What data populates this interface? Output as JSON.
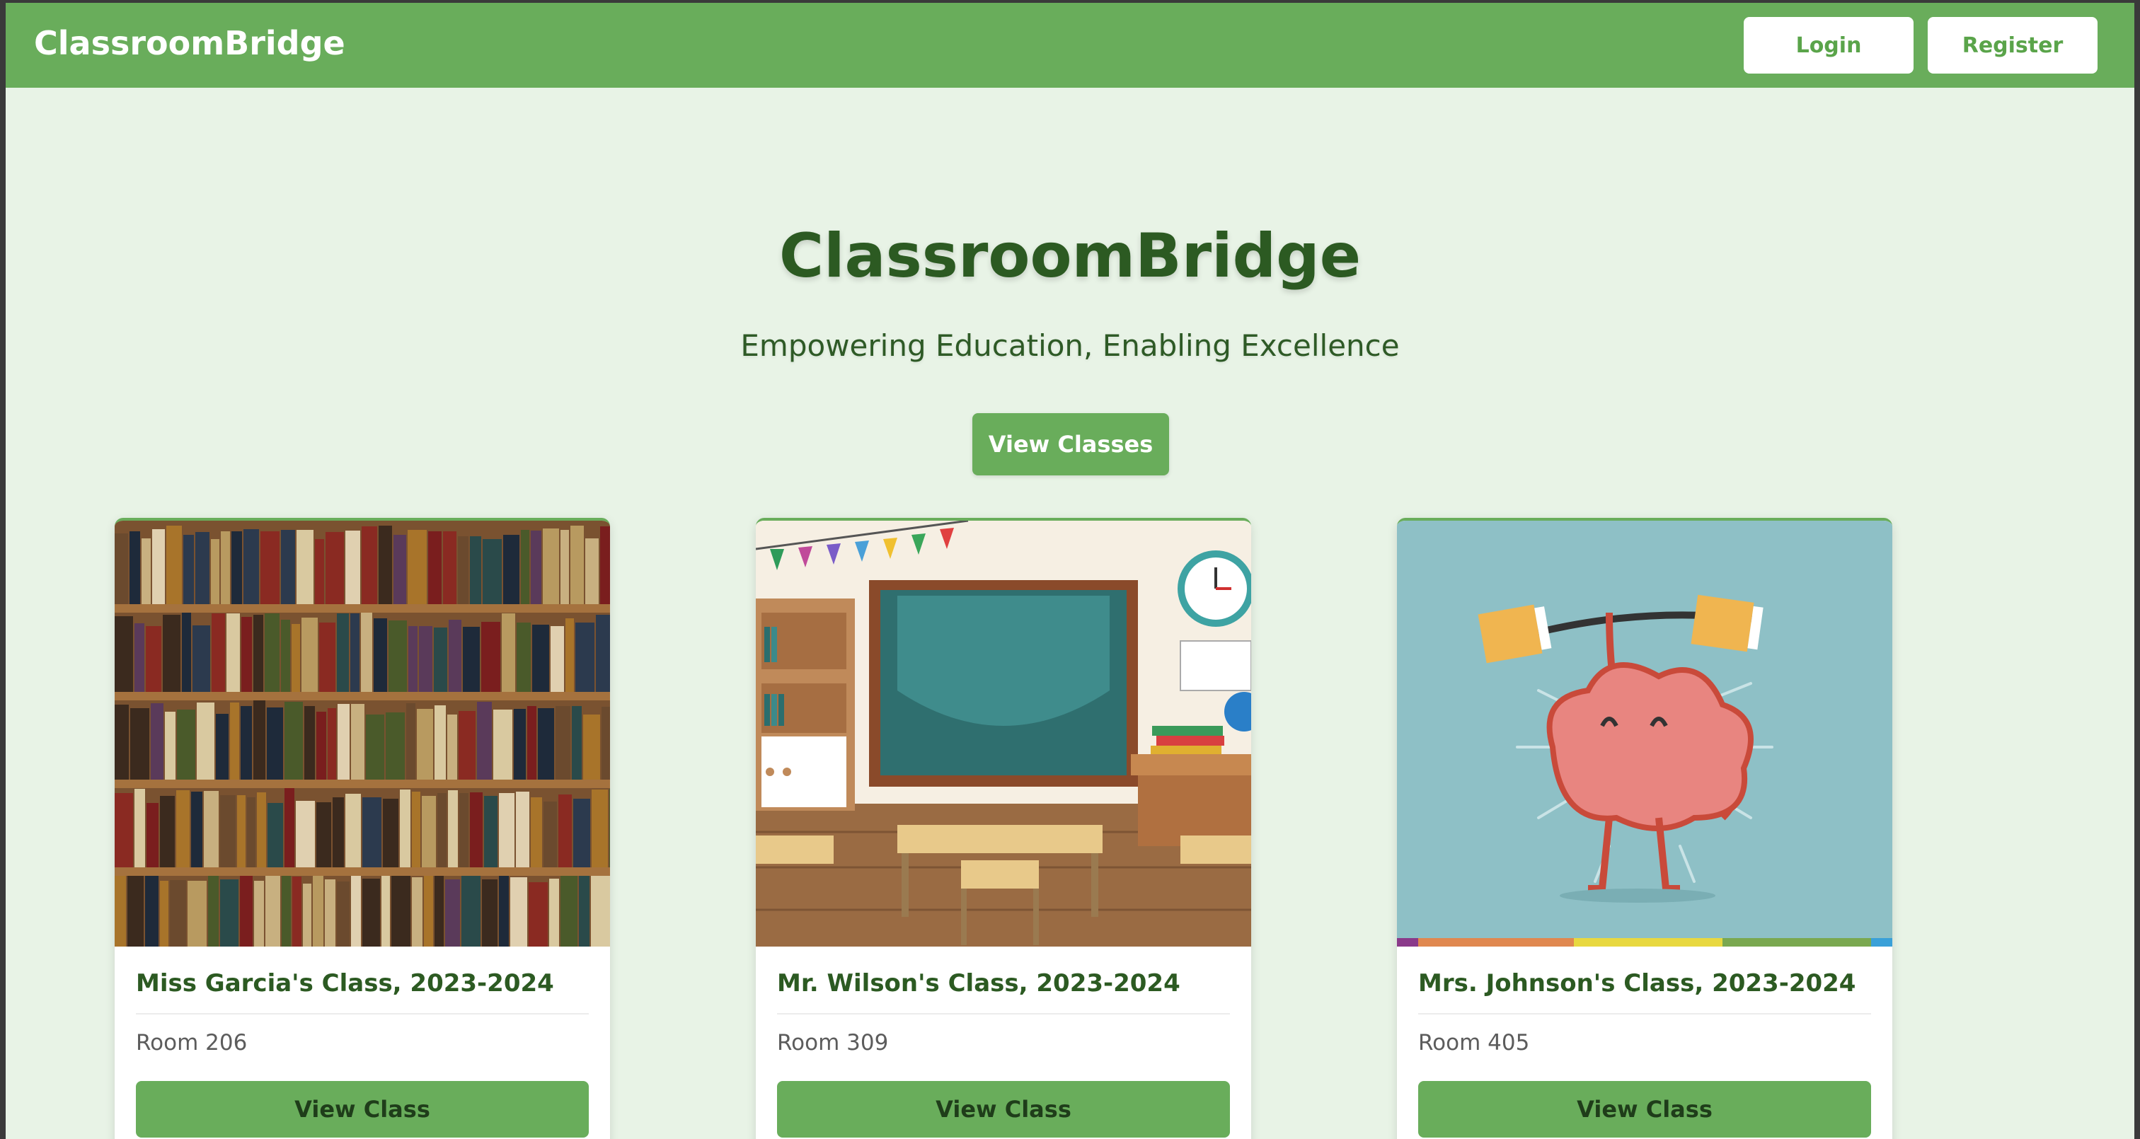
{
  "app": {
    "brand": "ClassroomBridge"
  },
  "nav": {
    "login_label": "Login",
    "register_label": "Register"
  },
  "hero": {
    "title": "ClassroomBridge",
    "subtitle": "Empowering Education, Enabling Excellence",
    "cta_label": "View Classes"
  },
  "classes": [
    {
      "title": "Miss Garcia's Class, 2023-2024",
      "room": "Room 206",
      "button_label": "View Class",
      "image": "bookshelf-photo"
    },
    {
      "title": "Mr. Wilson's Class, 2023-2024",
      "room": "Room 309",
      "button_label": "View Class",
      "image": "classroom-illustration"
    },
    {
      "title": "Mrs. Johnson's Class, 2023-2024",
      "room": "Room 405",
      "button_label": "View Class",
      "image": "brain-lifting-books-illustration"
    }
  ],
  "colors": {
    "primary": "#69ad5b",
    "page_background": "#e8f3e6",
    "heading": "#2c5a22"
  }
}
